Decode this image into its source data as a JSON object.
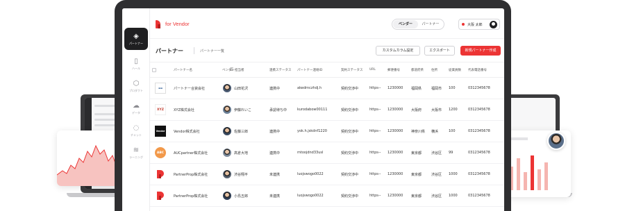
{
  "brand": {
    "logo_text": "for Vendor",
    "accent": "#EC3434"
  },
  "sidebar": {
    "items": [
      {
        "label": "パートナー",
        "icon": "partner-icon",
        "active": true
      },
      {
        "label": "ハール",
        "icon": "file-icon",
        "active": false
      },
      {
        "label": "プロダクト",
        "icon": "cube-icon",
        "active": false
      },
      {
        "label": "データ",
        "icon": "cloud-icon",
        "active": false
      },
      {
        "label": "チャット",
        "icon": "chat-icon",
        "active": false
      },
      {
        "label": "ラーニング",
        "icon": "learning-icon",
        "active": false
      }
    ]
  },
  "header": {
    "toggle": [
      "ベンダー",
      "パートナー"
    ],
    "user_name": "大阪 太郎"
  },
  "titlebar": {
    "title": "パートナー",
    "breadcrumb": "パートナー一覧",
    "btn_columns": "カスタムカラム設定",
    "btn_export": "エクスポート",
    "btn_new": "新規パートナー作成"
  },
  "table": {
    "columns": [
      "パートナー名",
      "ベンダー担当者",
      "連携ステータス",
      "パートナー連絡ID",
      "契約ステータス",
      "URL",
      "郵便番号",
      "都道府県",
      "住所",
      "従業員数",
      "代表電話番号"
    ],
    "rows": [
      {
        "logo": "samsonite",
        "name": "パートナー合資会社",
        "person": "山田花沢",
        "link_status": "連携中",
        "contact_id": "akedrnczhdj.h",
        "contract": "契約交渉中",
        "url": "https--",
        "zip": "1230000",
        "pref": "福岡県",
        "addr": "福岡市",
        "emp": "100",
        "tel": "0312345678"
      },
      {
        "logo": "XYZ",
        "name": "XYZ株式会社",
        "person": "伊藤れいこ",
        "link_status": "承認待ち中",
        "contact_id": "kurodabow00111",
        "contract": "契約交渉中",
        "url": "https--",
        "zip": "1230000",
        "pref": "大阪府",
        "addr": "大阪市",
        "emp": "1200",
        "tel": "0312345678"
      },
      {
        "logo": "Vendor",
        "name": "Vendor株式会社",
        "person": "佐藤三郎",
        "link_status": "連携中",
        "contact_id": "yok.h.jskdnf1220",
        "contract": "契約交渉中",
        "url": "https--",
        "zip": "1230000",
        "pref": "神奈川県",
        "addr": "横浜",
        "emp": "100",
        "tel": "0312345678"
      },
      {
        "logo": "ABC",
        "name": "AUCpartner株式会社",
        "person": "高倉大地",
        "link_status": "連携中",
        "contact_id": "mtoojdnd33usl",
        "contract": "契約交渉中",
        "url": "https--",
        "zip": "1230000",
        "pref": "東京都",
        "addr": "渋谷区",
        "emp": "99",
        "tel": "0312345678"
      },
      {
        "logo": "PartnerProp",
        "name": "PartnerProp株式会社",
        "person": "渋谷翔平",
        "link_status": "未連携",
        "contact_id": "luojswogo0022",
        "contract": "契約交渉中",
        "url": "https--",
        "zip": "1230000",
        "pref": "東京都",
        "addr": "渋谷区",
        "emp": "1000",
        "tel": "0312345678"
      },
      {
        "logo": "PartnerProp",
        "name": "PartnerProp株式会社",
        "person": "小島五郎",
        "link_status": "未連携",
        "contact_id": "luojswogo0022",
        "contract": "契約交渉中",
        "url": "https--",
        "zip": "1230000",
        "pref": "東京都",
        "addr": "渋谷区",
        "emp": "1000",
        "tel": "0312345678"
      }
    ]
  }
}
